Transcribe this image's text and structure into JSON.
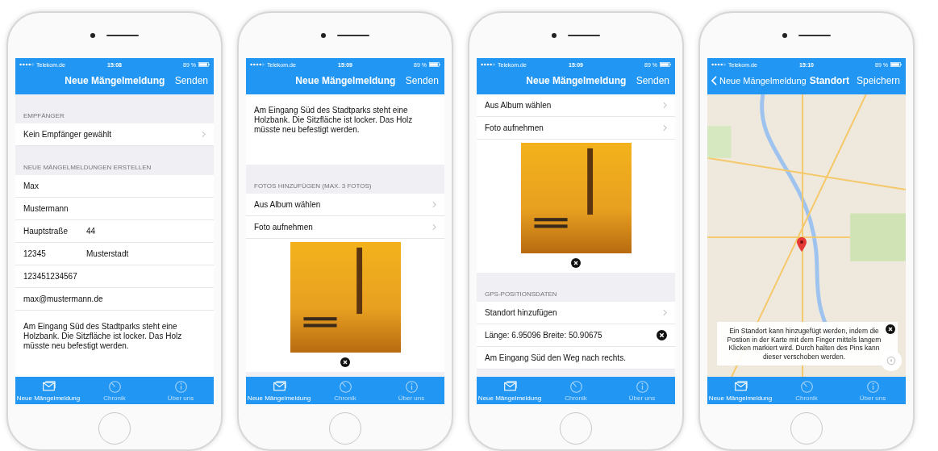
{
  "phones": [
    {
      "status_bar": {
        "carrier": "Telekom.de",
        "time": "15:08",
        "battery": "89 %"
      },
      "nav_bar": {
        "title": "Neue Mängelmeldung",
        "action": "Senden"
      },
      "content": [
        {
          "kind": "header",
          "text": "EMPFÄNGER"
        },
        {
          "kind": "link",
          "text": "Kein Empfänger gewählt"
        },
        {
          "kind": "header",
          "text": "NEUE MÄNGELMELDUNGEN ERSTELLEN"
        },
        {
          "kind": "field",
          "value": "Max"
        },
        {
          "kind": "field",
          "value": "Mustermann"
        },
        {
          "kind": "field_pair",
          "values": [
            "Hauptstraße",
            "44"
          ]
        },
        {
          "kind": "field_pair",
          "values": [
            "12345",
            "Musterstadt"
          ]
        },
        {
          "kind": "field",
          "value": "123451234567"
        },
        {
          "kind": "field",
          "value": "max@mustermann.de"
        },
        {
          "kind": "note",
          "text": "Am Eingang Süd des Stadtparks steht eine Holzbank. Die Sitzfläche ist locker. Das Holz müsste neu befestigt werden."
        }
      ],
      "tab_bar": [
        {
          "label": "Neue Mängelmeldung",
          "selected": true
        },
        {
          "label": "Chronik",
          "selected": false
        },
        {
          "label": "Über uns",
          "selected": false
        }
      ]
    },
    {
      "status_bar": {
        "carrier": "Telekom.de",
        "time": "15:09",
        "battery": "89 %"
      },
      "nav_bar": {
        "title": "Neue Mängelmeldung",
        "action": "Senden"
      },
      "content": [
        {
          "kind": "note",
          "text": "Am Eingang Süd des Stadtparks steht eine Holzbank. Die Sitzfläche ist locker. Das Holz müsste neu befestigt werden."
        },
        {
          "kind": "header",
          "text": "FOTOS HINZUFÜGEN (MAX. 3 FOTOS)"
        },
        {
          "kind": "link",
          "text": "Aus Album wählen"
        },
        {
          "kind": "link",
          "text": "Foto aufnehmen"
        },
        {
          "kind": "photo"
        }
      ],
      "tab_bar": [
        {
          "label": "Neue Mängelmeldung",
          "selected": true
        },
        {
          "label": "Chronik",
          "selected": false
        },
        {
          "label": "Über uns",
          "selected": false
        }
      ]
    },
    {
      "status_bar": {
        "carrier": "Telekom.de",
        "time": "15:09",
        "battery": "89 %"
      },
      "nav_bar": {
        "title": "Neue Mängelmeldung",
        "action": "Senden"
      },
      "content": [
        {
          "kind": "link",
          "text": "Aus Album wählen"
        },
        {
          "kind": "link",
          "text": "Foto aufnehmen"
        },
        {
          "kind": "photo"
        },
        {
          "kind": "header",
          "text": "GPS-POSITIONSDATEN"
        },
        {
          "kind": "link",
          "text": "Standort hinzufügen"
        },
        {
          "kind": "location",
          "text": "Länge: 6.95096 Breite: 50.90675"
        },
        {
          "kind": "field",
          "value": "Am Eingang Süd den Weg nach rechts."
        }
      ],
      "tab_bar": [
        {
          "label": "Neue Mängelmeldung",
          "selected": true
        },
        {
          "label": "Chronik",
          "selected": false
        },
        {
          "label": "Über uns",
          "selected": false
        }
      ]
    },
    {
      "status_bar": {
        "carrier": "Telekom.de",
        "time": "15:10",
        "battery": "89 %"
      },
      "nav_bar": {
        "back": "Neue Mängelmeldung",
        "title": "Standort",
        "action": "Speichern"
      },
      "content": [
        {
          "kind": "map",
          "hint": "Ein Standort kann hinzugefügt werden, indem die Postion in der Karte mit dem Finger mittels langem Klicken markiert wird. Durch halten des Pins kann dieser verschoben werden."
        }
      ],
      "tab_bar": [
        {
          "label": "Neue Mängelmeldung",
          "selected": true
        },
        {
          "label": "Chronik",
          "selected": false
        },
        {
          "label": "Über uns",
          "selected": false
        }
      ]
    }
  ]
}
